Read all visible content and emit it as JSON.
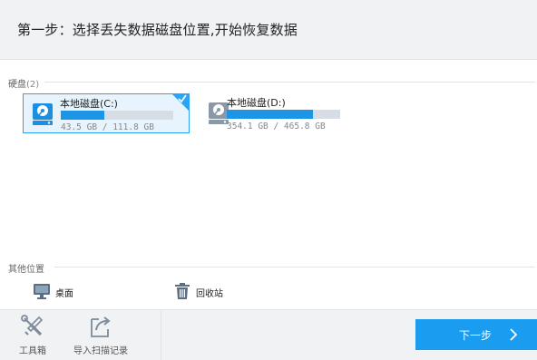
{
  "header": {
    "title": "第一步：选择丢失数据磁盘位置,开始恢复数据"
  },
  "disks_section": {
    "label": "硬盘",
    "count": "(2)"
  },
  "disks": [
    {
      "name": "本地磁盘(C:)",
      "size_text": "43.5 GB / 111.8 GB",
      "used_fraction": 0.389,
      "selected": true,
      "icon": "hard-drive-icon"
    },
    {
      "name": "本地磁盘(D:)",
      "size_text": "354.1 GB / 465.8 GB",
      "used_fraction": 0.76,
      "selected": false,
      "icon": "hard-drive-icon"
    }
  ],
  "other_section": {
    "label": "其他位置"
  },
  "locations": [
    {
      "label": "桌面",
      "icon": "monitor-icon"
    },
    {
      "label": "回收站",
      "icon": "trash-icon"
    }
  ],
  "footer": {
    "tools": [
      {
        "label": "工具箱",
        "icon": "tools-icon"
      },
      {
        "label": "导入扫描记录",
        "icon": "import-icon"
      }
    ],
    "next_label": "下一步"
  },
  "colors": {
    "accent": "#1a9cf0",
    "selected_bg": "#e7f4fd",
    "bar_bg": "#d6dde5",
    "bar_fill": "#1c95e6"
  }
}
